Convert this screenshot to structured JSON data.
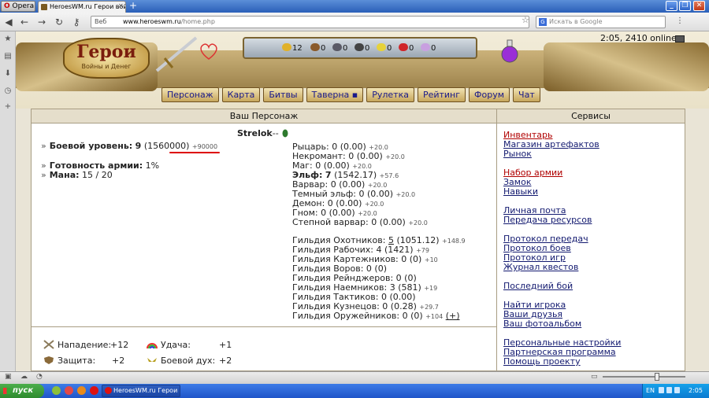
{
  "browser": {
    "menu_label": "Opera",
    "tab_title": "HeroesWM.ru Герои вой...",
    "address_prefix": "Веб",
    "url_host": "www.heroeswm.ru",
    "url_path": "/home.php",
    "search_placeholder": "Искать в Google",
    "search_engine": "G"
  },
  "header": {
    "logo_title": "Герои",
    "logo_subtitle": "Войны и Денег",
    "resources": [
      "12",
      "0",
      "0",
      "0",
      "0",
      "0",
      "0"
    ],
    "time_online": "2:05, 2410 online"
  },
  "menu": [
    "Персонаж",
    "Карта",
    "Битвы",
    "Таверна",
    "Рулетка",
    "Рейтинг",
    "Форум",
    "Чат"
  ],
  "character": {
    "section_title": "Ваш Персонаж",
    "name": "Strelok",
    "name_suffix": "--",
    "combat_level_label": "Боевой уровень:",
    "combat_level": "9",
    "combat_exp": "(1560000)",
    "combat_exp_bonus": "+90000",
    "army_ready_label": "Готовность армии:",
    "army_ready": "1%",
    "mana_label": "Мана:",
    "mana": "15 / 20"
  },
  "factions": [
    {
      "name": "Рыцарь:",
      "level": "0",
      "value": "(0.00)",
      "bonus": "+20.0",
      "bold": false
    },
    {
      "name": "Некромант:",
      "level": "0",
      "value": "(0.00)",
      "bonus": "+20.0",
      "bold": false
    },
    {
      "name": "Маг:",
      "level": "0",
      "value": "(0.00)",
      "bonus": "+20.0",
      "bold": false
    },
    {
      "name": "Эльф:",
      "level": "7",
      "value": "(1542.17)",
      "bonus": "+57.6",
      "bold": true
    },
    {
      "name": "Варвар:",
      "level": "0",
      "value": "(0.00)",
      "bonus": "+20.0",
      "bold": false
    },
    {
      "name": "Темный эльф:",
      "level": "0",
      "value": "(0.00)",
      "bonus": "+20.0",
      "bold": false
    },
    {
      "name": "Демон:",
      "level": "0",
      "value": "(0.00)",
      "bonus": "+20.0",
      "bold": false
    },
    {
      "name": "Гном:",
      "level": "0",
      "value": "(0.00)",
      "bonus": "+20.0",
      "bold": false
    },
    {
      "name": "Степной варвар:",
      "level": "0",
      "value": "(0.00)",
      "bonus": "+20.0",
      "bold": false
    }
  ],
  "guilds": [
    {
      "name": "Гильдия Охотников:",
      "level": "5",
      "value": "(1051.12)",
      "bonus": "+148.9"
    },
    {
      "name": "Гильдия Рабочих:",
      "level": "4",
      "value": "(1421)",
      "bonus": "+79"
    },
    {
      "name": "Гильдия Картежников:",
      "level": "0",
      "value": "(0)",
      "bonus": "+10"
    },
    {
      "name": "Гильдия Воров:",
      "level": "0",
      "value": "(0)",
      "bonus": ""
    },
    {
      "name": "Гильдия Рейнджеров:",
      "level": "0",
      "value": "(0)",
      "bonus": ""
    },
    {
      "name": "Гильдия Наемников:",
      "level": "3",
      "value": "(581)",
      "bonus": "+19"
    },
    {
      "name": "Гильдия Тактиков:",
      "level": "0",
      "value": "(0.00)",
      "bonus": ""
    },
    {
      "name": "Гильдия Кузнецов:",
      "level": "0",
      "value": "(0.28)",
      "bonus": "+29.7"
    },
    {
      "name": "Гильдия Оружейников:",
      "level": "0",
      "value": "(0)",
      "bonus": "+104",
      "extra": "(+)"
    }
  ],
  "bottom_stats": {
    "attack_label": "Нападение:",
    "attack": "+12",
    "luck_label": "Удача:",
    "luck": "+1",
    "defense_label": "Защита:",
    "defense": "+2",
    "morale_label": "Боевой дух:",
    "morale": "+2"
  },
  "services": {
    "title": "Сервисы",
    "groups": [
      [
        "Инвентарь",
        "Магазин артефактов",
        "Рынок"
      ],
      [
        "Набор армии",
        "Замок",
        "Навыки"
      ],
      [
        "Личная почта",
        "Передача ресурсов"
      ],
      [
        "Протокол передач",
        "Протокол боев",
        "Протокол игр",
        "Журнал квестов"
      ],
      [
        "Последний бой"
      ],
      [
        "Найти игрока",
        "Ваши друзья",
        "Ваш фотоальбом"
      ],
      [
        "Персональные настройки",
        "Партнерская программа",
        "Помощь проекту"
      ]
    ]
  },
  "taskbar": {
    "start_label": "пуск",
    "task_label": "HeroesWM.ru Герои ...",
    "lang": "EN",
    "time": "2:05"
  }
}
